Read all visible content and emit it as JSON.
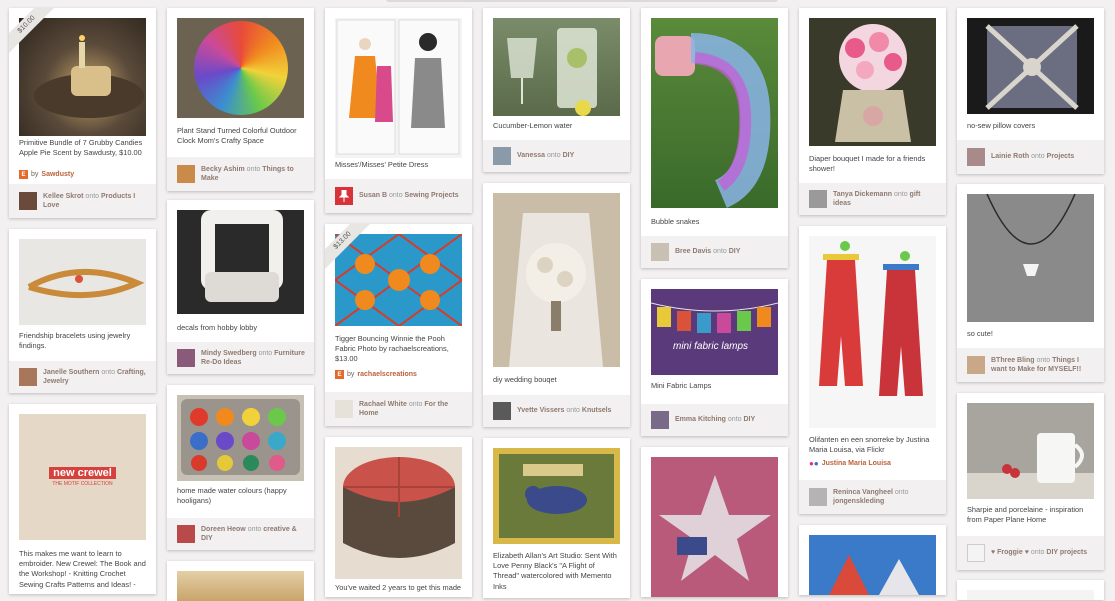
{
  "columns": [
    [
      {
        "price": "$10.00",
        "desc": "Primitive Bundle of 7 Grubby Candies Apple Pie Scent by Sawdusty, $10.00",
        "via": "by",
        "via_name": "Sawdusty",
        "user": "Kellee Skrot",
        "board": "Products I Love",
        "img": "candles-image",
        "colors": [
          "#5a4a3a",
          "#c9a56a",
          "#2c241c"
        ]
      },
      {
        "desc": "Friendship bracelets using jewelry findings.",
        "user": "Janelle Southern",
        "board": "Crafting, Jewelry",
        "img": "bracelet-image",
        "colors": [
          "#e9e7e4",
          "#c98b3a",
          "#d9d4cd"
        ]
      },
      {
        "desc": "This makes me want to learn to embroider. New Crewel: The Book and the Workshop! - Knitting Crochet Sewing Crafts Patterns and Ideas! -",
        "img": "book-cover-image",
        "colors": [
          "#e5d8c6",
          "#d7413d",
          "#c9bba6"
        ],
        "book_title": "new crewel",
        "book_sub": "THE MOTIF COLLECTION"
      }
    ],
    [
      {
        "desc": "Plant Stand Turned Colorful Outdoor Clock Mom's Crafty Space",
        "user": "Becky Ashim",
        "board": "Things to Make",
        "img": "rainbow-clock-image",
        "colors": [
          "#6b6251",
          "#e84a3a",
          "#3b8fcf"
        ]
      },
      {
        "desc": "decals from hobby lobby",
        "user": "Mindy Swedberg",
        "board": "Furniture Re-Do Ideas",
        "img": "chair-image",
        "colors": [
          "#2a2a2a",
          "#dedbd6",
          "#9a948c"
        ]
      },
      {
        "desc": "home made water colours (happy hooligans)",
        "user": "Doreen Heow",
        "board": "creative & DIY",
        "img": "paint-tray-image",
        "colors": [
          "#c7c0b4",
          "#e03a2a",
          "#3a6ec9"
        ]
      },
      {
        "img": "wooden-box-image",
        "colors": [
          "#c9a46a",
          "#a57e45",
          "#e3cfa6"
        ]
      }
    ],
    [
      {
        "desc": "Misses'/Misses' Petite Dress",
        "user": "Susan B",
        "board": "Sewing Projects",
        "img": "dress-pattern-image",
        "colors": [
          "#f4f4f4",
          "#d94a8a",
          "#777777"
        ]
      },
      {
        "price": "$13.00",
        "desc": "Tigger Bouncing Winnie the Pooh Fabric Photo by rachaelscreations, $13.00",
        "via": "by",
        "via_name": "rachaelscreations",
        "user": "Rachael White",
        "board": "For the Home",
        "img": "tigger-board-image",
        "colors": [
          "#2a98c9",
          "#f08a1e",
          "#d93a2a"
        ]
      },
      {
        "desc": "You've waited 2 years to get this made",
        "img": "ottoman-image",
        "colors": [
          "#c9534a",
          "#5a4a3e",
          "#e6dccf"
        ]
      }
    ],
    [
      {
        "desc": "Cucumber-Lemon water",
        "user": "Vanessa",
        "board": "DIY",
        "img": "water-glass-image",
        "colors": [
          "#7a8c6a",
          "#dfe6d6",
          "#a8c06a"
        ]
      },
      {
        "desc": "diy wedding bouqet",
        "user": "Yvette Vissers",
        "board": "Knutsels",
        "img": "bride-bouquet-image",
        "colors": [
          "#eae6df",
          "#c9bda8",
          "#8a7d6a"
        ]
      },
      {
        "desc": "Elizabeth Allan's Art Studio: Sent With Love Penny Black's \"A Flight of Thread\" watercolored with Memento Inks",
        "img": "bird-card-image",
        "colors": [
          "#6a7a3a",
          "#3a4a8a",
          "#d9b84a"
        ]
      }
    ],
    [
      {
        "desc": "Bubble snakes",
        "user": "Bree Davis",
        "board": "DIY",
        "img": "bubble-snake-image",
        "colors": [
          "#5a8a3a",
          "#c95ad9",
          "#8ab4e8"
        ]
      },
      {
        "desc": "Mini Fabric Lamps",
        "user": "Emma Kitching",
        "board": "DIY",
        "img": "fabric-lamps-image",
        "colors": [
          "#5a3a7a",
          "#e8c93a",
          "#d9533a"
        ],
        "overlay": "mini fabric lamps"
      },
      {
        "img": "usa-star-image",
        "colors": [
          "#b95a7a",
          "#e6e6ea",
          "#3a4a8a"
        ]
      }
    ],
    [
      {
        "desc": "Diaper bouquet I made for a friends shower!",
        "user": "Tanya Dickemann",
        "board": "gift ideas",
        "img": "diaper-bouquet-image",
        "colors": [
          "#3a3a2a",
          "#e85a8a",
          "#c9c0a6"
        ]
      },
      {
        "desc": "Olifanten en een snorreke by Justina Maria Louisa, via Flickr",
        "via": "dots",
        "via_name": "Justina Maria Louisa",
        "user": "Reninca Vangheel",
        "board": "jongenskleding",
        "img": "overalls-image",
        "colors": [
          "#f6f6f6",
          "#d93a3a",
          "#3a7ac9"
        ]
      },
      {
        "img": "origami-image",
        "colors": [
          "#3a7ac9",
          "#d94a3a",
          "#e6e6ea"
        ]
      }
    ],
    [
      {
        "desc": "no-sew pillow covers",
        "user": "Lainie Roth",
        "board": "Projects",
        "img": "pillow-image",
        "colors": [
          "#1a1a1a",
          "#6a6e80",
          "#d9d5cc"
        ]
      },
      {
        "desc": "so cute!",
        "user": "BThree Bling",
        "board": "Things I want to Make for MYSELF!!",
        "img": "necklace-image",
        "colors": [
          "#8a8a8a",
          "#cfcfcf",
          "#f4f4f4"
        ]
      },
      {
        "desc": "Sharpie and porcelaine - inspiration from Paper Plane Home",
        "user": "♥ Froggie ♥",
        "board": "DIY projects",
        "img": "mug-image",
        "colors": [
          "#a8a49e",
          "#f6f6f4",
          "#c9333a"
        ]
      },
      {
        "img": "blank-image",
        "colors": [
          "#f4f4f4",
          "#e6e6e6",
          "#dddddd"
        ]
      }
    ]
  ],
  "labels": {
    "onto": "onto"
  }
}
